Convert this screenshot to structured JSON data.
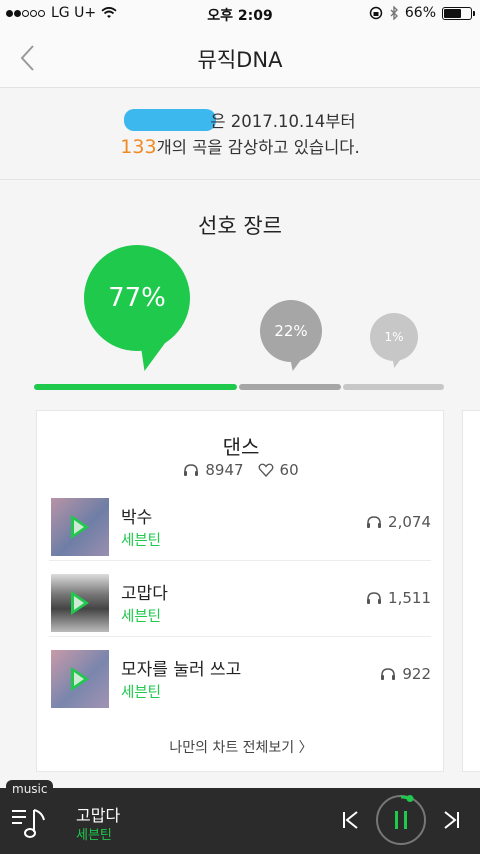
{
  "status_bar": {
    "carrier": "LG U+",
    "time": "오후 2:09",
    "battery": "66%",
    "battery_level": 0.66
  },
  "nav": {
    "title": "뮤직DNA",
    "back_icon": "chevron-left-icon"
  },
  "summary": {
    "line1_suffix": "은 2017.10.14부터",
    "count": "133",
    "line2_suffix": "개의 곡을 감상하고 있습니다."
  },
  "preferred_genre": {
    "title": "선호 장르",
    "bubbles": [
      {
        "label": "77%",
        "value": 77
      },
      {
        "label": "22%",
        "value": 22
      },
      {
        "label": "1%",
        "value": 1
      }
    ],
    "bar_colors": [
      "#1ec94b",
      "#a6a6a6",
      "#c7c7c7"
    ]
  },
  "card": {
    "genre": "댄스",
    "listens": "8947",
    "likes": "60",
    "songs": [
      {
        "title": "박수",
        "artist": "세븐틴",
        "plays": "2,074"
      },
      {
        "title": "고맙다",
        "artist": "세븐틴",
        "plays": "1,511"
      },
      {
        "title": "모자를 눌러 쓰고",
        "artist": "세븐틴",
        "plays": "922"
      }
    ],
    "more_label": "나만의 차트 전체보기 〉"
  },
  "player": {
    "tag": "music",
    "song": "고맙다",
    "artist": "세븐틴"
  },
  "colors": {
    "accent": "#1ec94b",
    "orange": "#f08a24",
    "player_bg": "#2b2b2b"
  }
}
